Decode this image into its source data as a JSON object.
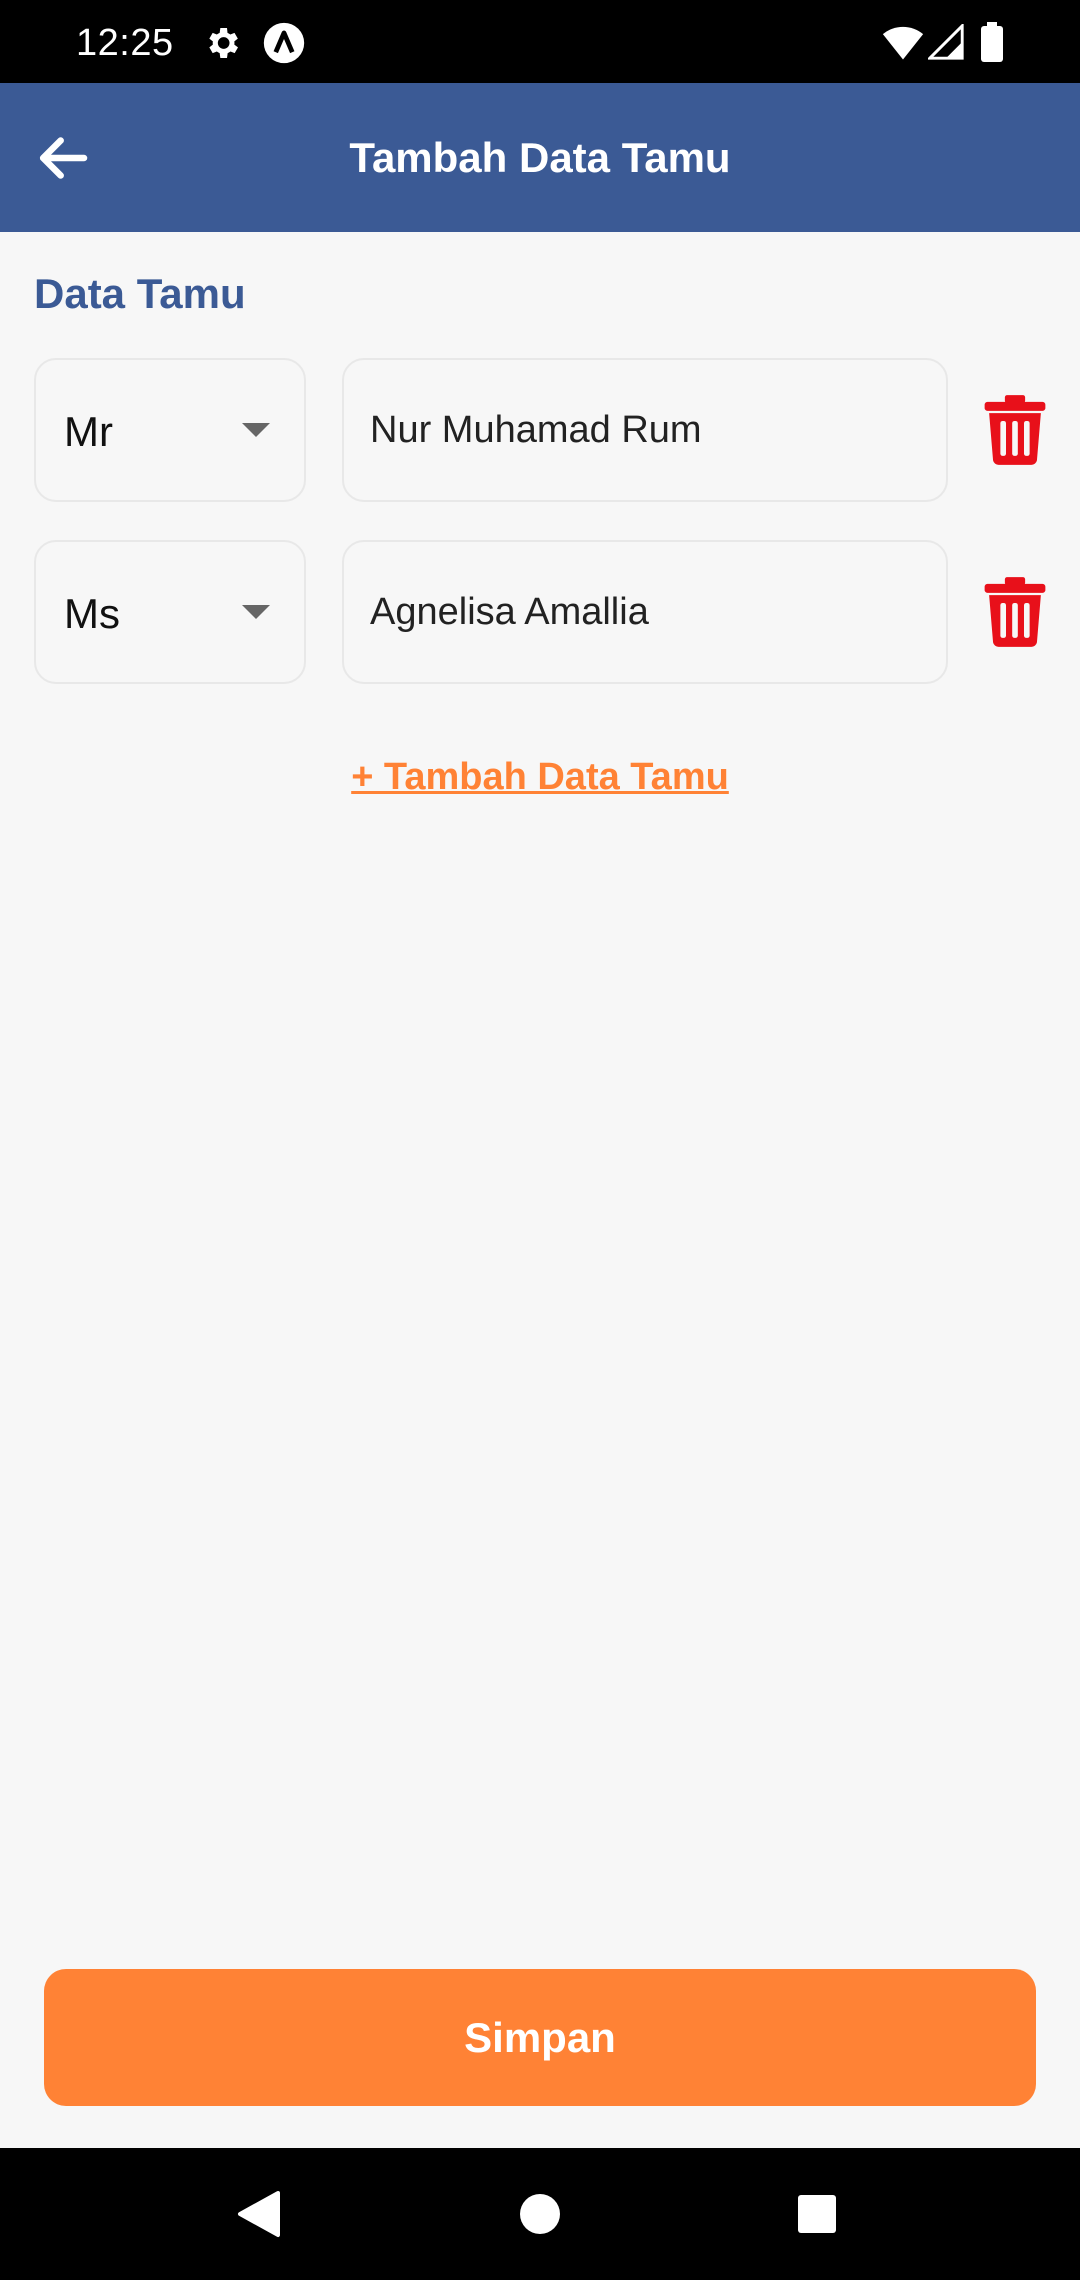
{
  "status_bar": {
    "time": "12:25",
    "icons": [
      "settings-gear-icon",
      "accessibility-a-icon",
      "wifi-icon",
      "signal-icon",
      "battery-icon"
    ]
  },
  "app_bar": {
    "title": "Tambah Data Tamu",
    "back_icon": "arrow-back-icon"
  },
  "section": {
    "title": "Data Tamu"
  },
  "guests": [
    {
      "title": "Mr",
      "name": "Nur Muhamad Rum",
      "delete_icon": "trash-icon"
    },
    {
      "title": "Ms",
      "name": "Agnelisa Amallia",
      "delete_icon": "trash-icon"
    }
  ],
  "add_guest_label": "+ Tambah Data Tamu",
  "save_label": "Simpan",
  "colors": {
    "primary": "#3b5a95",
    "accent": "#ff8235",
    "delete": "#e8101a",
    "background": "#f7f7f7"
  },
  "nav_bar": {
    "icons": [
      "nav-back-icon",
      "nav-home-icon",
      "nav-recents-icon"
    ]
  }
}
